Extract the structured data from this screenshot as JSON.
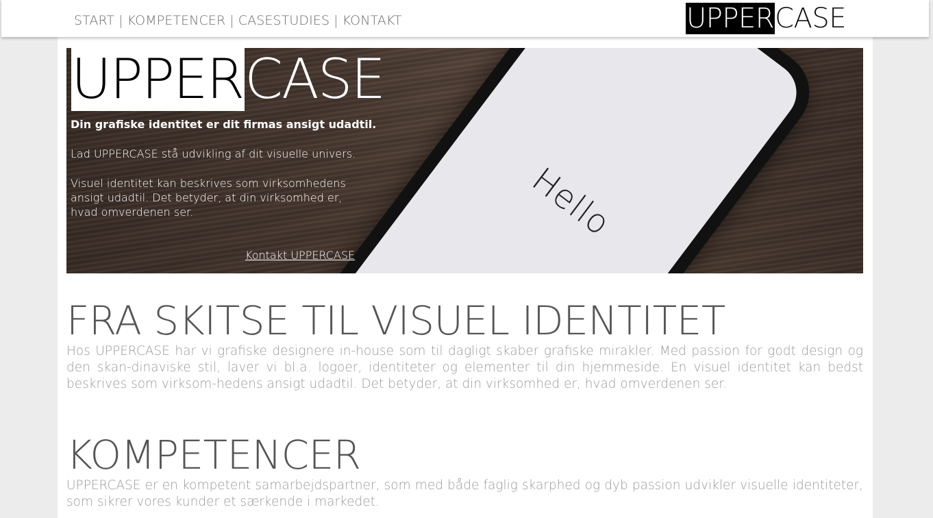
{
  "nav": {
    "items": [
      "START",
      "KOMPETENCER",
      "CASESTUDIES",
      "KONTAKT"
    ],
    "separator": "|"
  },
  "brand": {
    "inverted": "UPPER",
    "rest": "CASE"
  },
  "hero": {
    "logo_inverted": "UPPER",
    "logo_rest": "CASE",
    "tagline": "Din grafiske identitet er dit firmas ansigt udadtil.",
    "paragraph1": "Lad UPPERCASE stå udvikling af dit visuelle univers.",
    "paragraph2": "Visuel identitet kan beskrives som virksomhedens ansigt udadtil. Det betyder, at din virksomhed er, hvad omverdenen ser.",
    "cta": "Kontakt UPPERCASE",
    "phone_text": "Hello"
  },
  "sections": [
    {
      "heading": "FRA SKITSE TIL VISUEL IDENTITET",
      "text": "Hos UPPERCASE har vi grafiske designere in-house som til dagligt skaber grafiske mirakler. Med passion for godt design og den skan-dinaviske stil, laver vi bl.a. logoer, identiteter og elementer til din hjemmeside. En visuel identitet kan bedst beskrives som virksom-hedens ansigt udadtil. Det betyder, at din virksomhed er, hvad omverdenen ser."
    },
    {
      "heading": "KOMPETENCER",
      "text": "UPPERCASE er en kompetent samarbejdspartner, som med både faglig skarphed og dyb passion udvikler visuelle identiteter, som sikrer vores kunder et særkende i markedet."
    }
  ],
  "colors": {
    "background": "#ececec",
    "panel": "#ffffff",
    "heading": "#555555",
    "body_text": "#9a9a9a"
  }
}
